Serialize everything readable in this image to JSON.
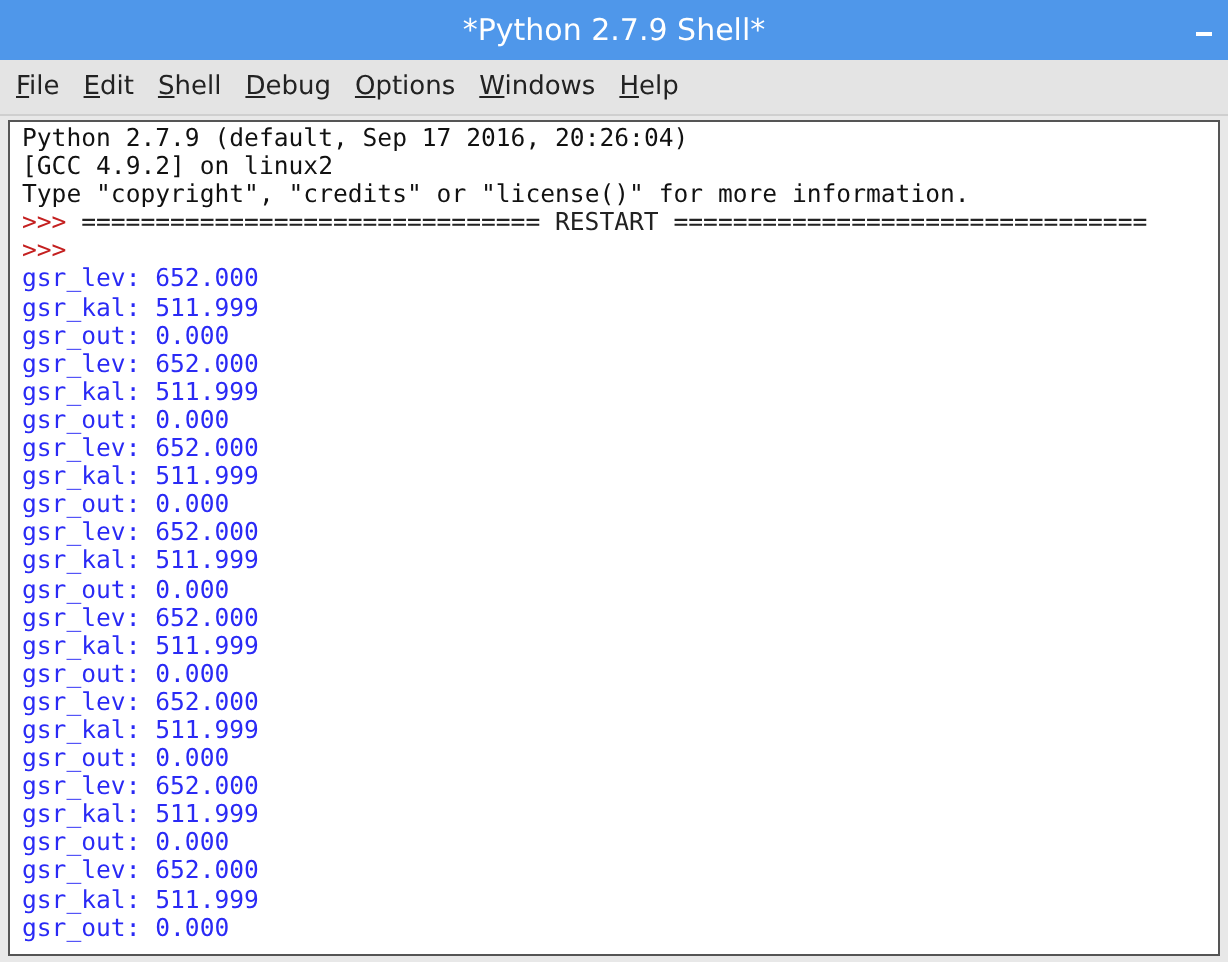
{
  "window": {
    "title": "*Python 2.7.9 Shell*"
  },
  "menu": [
    {
      "label": "File"
    },
    {
      "label": "Edit"
    },
    {
      "label": "Shell"
    },
    {
      "label": "Debug"
    },
    {
      "label": "Options"
    },
    {
      "label": "Windows"
    },
    {
      "label": "Help"
    }
  ],
  "shell_lines": [
    {
      "kind": "banner",
      "text": "Python 2.7.9 (default, Sep 17 2016, 20:26:04)"
    },
    {
      "kind": "banner",
      "text": "[GCC 4.9.2] on linux2"
    },
    {
      "kind": "banner",
      "text": "Type \"copyright\", \"credits\" or \"license()\" for more information."
    },
    {
      "kind": "restart",
      "prompt": ">>>",
      "text": "=============================== RESTART ================================"
    },
    {
      "kind": "prompt",
      "prompt": ">>>"
    },
    {
      "kind": "output",
      "text": "gsr_lev: 652.000"
    },
    {
      "kind": "output",
      "text": "gsr_kal: 511.999"
    },
    {
      "kind": "output",
      "text": "gsr_out: 0.000"
    },
    {
      "kind": "output",
      "text": "gsr_lev: 652.000"
    },
    {
      "kind": "output",
      "text": "gsr_kal: 511.999"
    },
    {
      "kind": "output",
      "text": "gsr_out: 0.000"
    },
    {
      "kind": "output",
      "text": "gsr_lev: 652.000"
    },
    {
      "kind": "output",
      "text": "gsr_kal: 511.999"
    },
    {
      "kind": "output",
      "text": "gsr_out: 0.000"
    },
    {
      "kind": "output",
      "text": "gsr_lev: 652.000"
    },
    {
      "kind": "output",
      "text": "gsr_kal: 511.999"
    },
    {
      "kind": "output",
      "text": "gsr_out: 0.000"
    },
    {
      "kind": "output",
      "text": "gsr_lev: 652.000"
    },
    {
      "kind": "output",
      "text": "gsr_kal: 511.999"
    },
    {
      "kind": "output",
      "text": "gsr_out: 0.000"
    },
    {
      "kind": "output",
      "text": "gsr_lev: 652.000"
    },
    {
      "kind": "output",
      "text": "gsr_kal: 511.999"
    },
    {
      "kind": "output",
      "text": "gsr_out: 0.000"
    },
    {
      "kind": "output",
      "text": "gsr_lev: 652.000"
    },
    {
      "kind": "output",
      "text": "gsr_kal: 511.999"
    },
    {
      "kind": "output",
      "text": "gsr_out: 0.000"
    },
    {
      "kind": "output",
      "text": "gsr_lev: 652.000"
    },
    {
      "kind": "output",
      "text": "gsr_kal: 511.999"
    },
    {
      "kind": "output",
      "text": "gsr_out: 0.000"
    }
  ]
}
